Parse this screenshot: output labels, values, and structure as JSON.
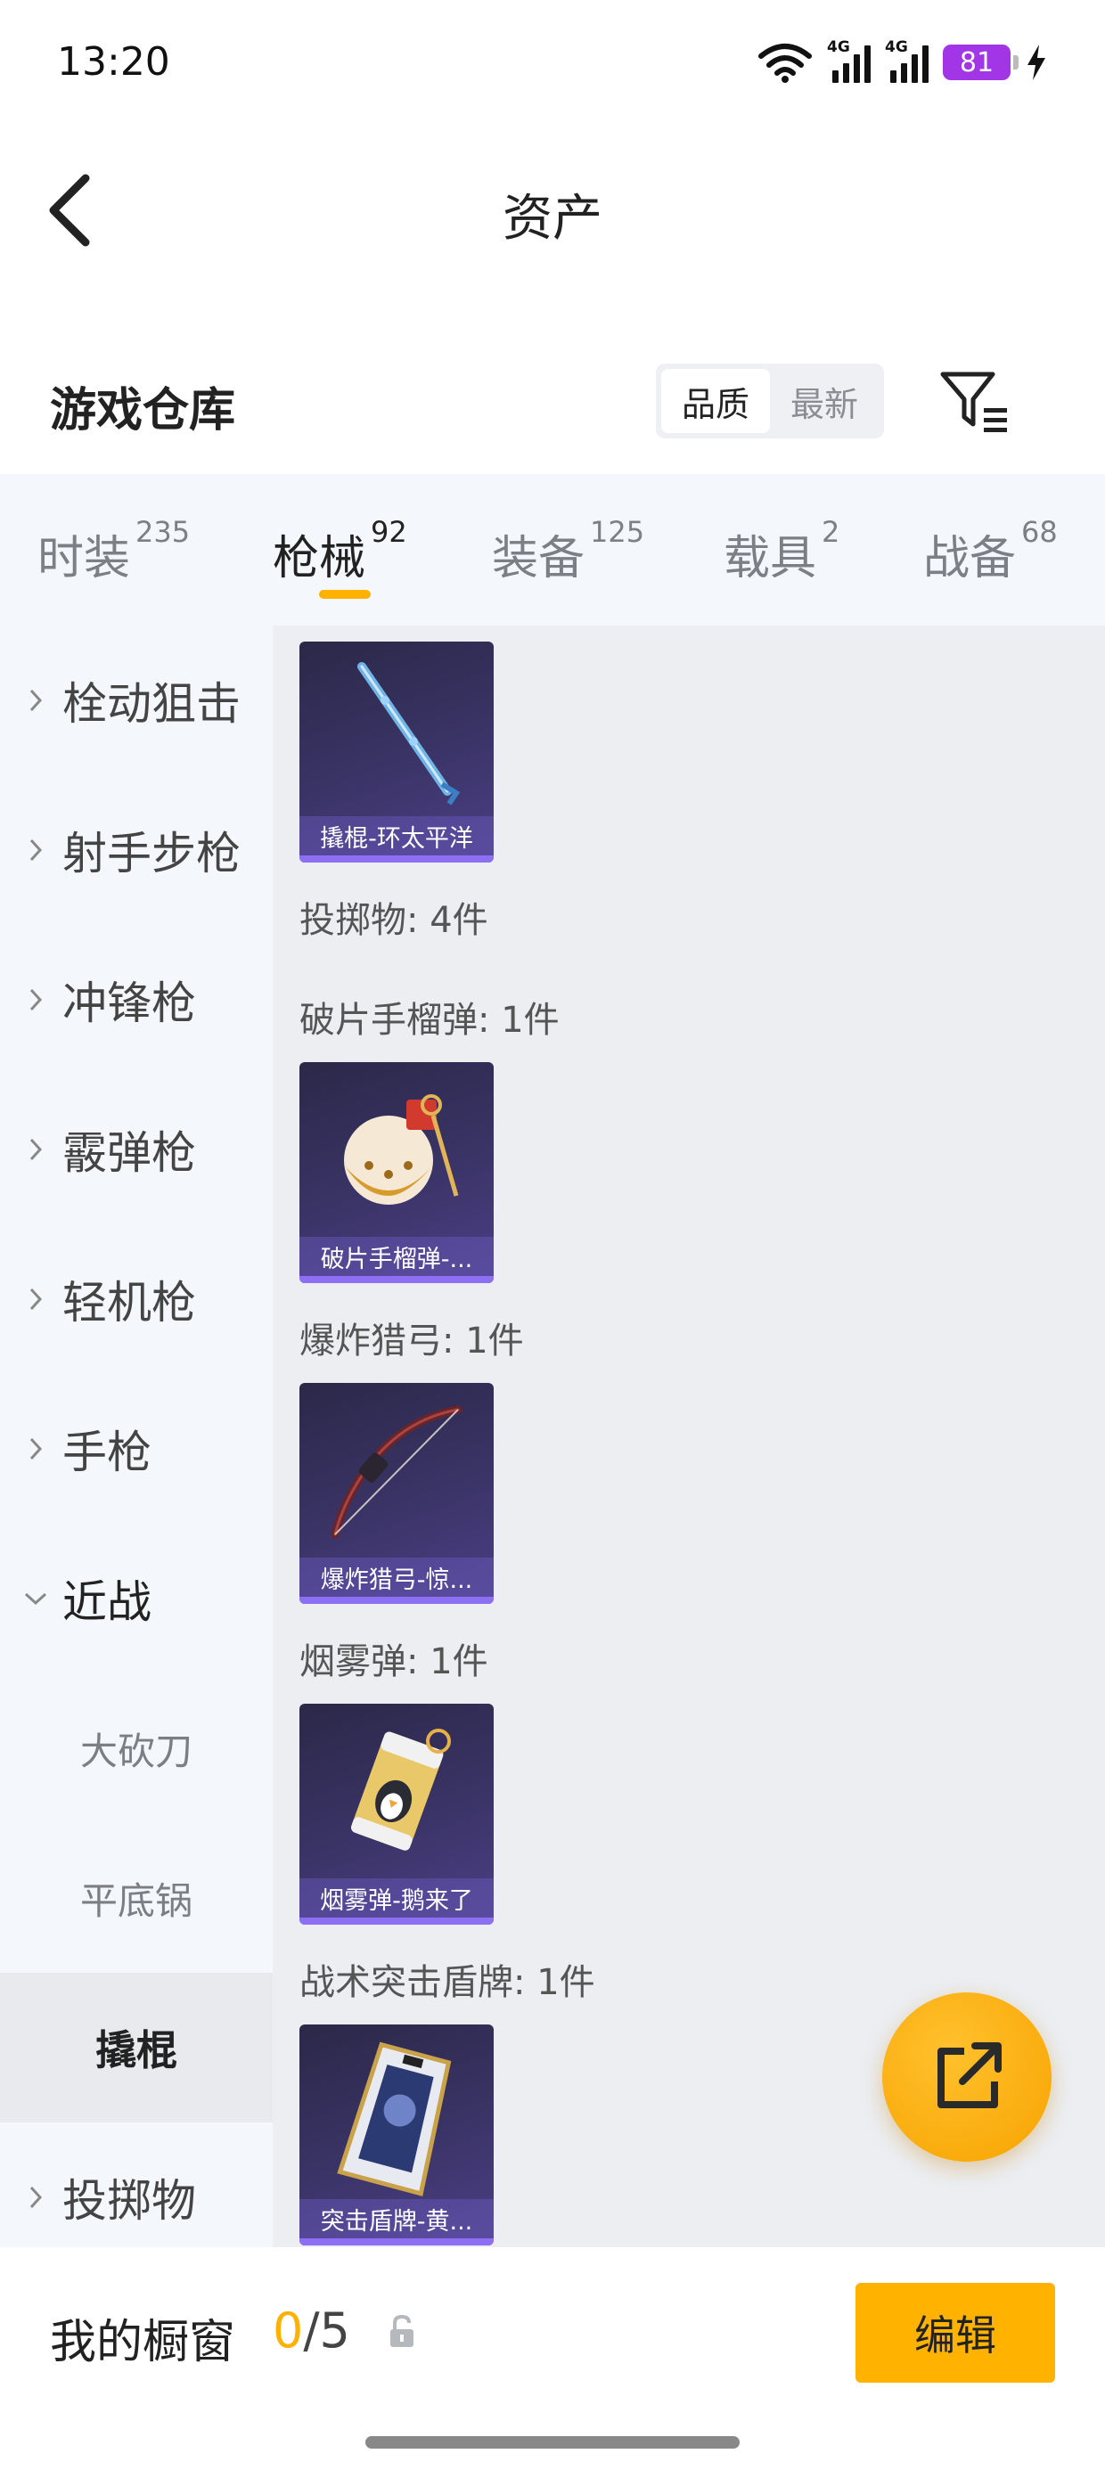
{
  "status_bar": {
    "time": "13:20",
    "network_1": "4G",
    "network_2": "4G",
    "battery": "81"
  },
  "header": {
    "title": "资产",
    "back_icon": "back-arrow-icon"
  },
  "warehouse": {
    "title": "游戏仓库",
    "sort_options": [
      "品质",
      "最新"
    ],
    "sort_selected": "品质",
    "filter_icon": "filter-icon"
  },
  "tabs": [
    {
      "label": "时装",
      "count": "235"
    },
    {
      "label": "枪械",
      "count": "92"
    },
    {
      "label": "装备",
      "count": "125"
    },
    {
      "label": "载具",
      "count": "2"
    },
    {
      "label": "战备",
      "count": "68"
    }
  ],
  "active_tab": "枪械",
  "sidebar": {
    "categories": [
      {
        "label": "栓动狙击"
      },
      {
        "label": "射手步枪"
      },
      {
        "label": "冲锋枪"
      },
      {
        "label": "霰弹枪"
      },
      {
        "label": "轻机枪"
      },
      {
        "label": "手枪"
      },
      {
        "label": "近战"
      }
    ],
    "subcategories": [
      {
        "label": "大砍刀"
      },
      {
        "label": "平底锅"
      },
      {
        "label": "撬棍"
      }
    ],
    "after": {
      "label": "投掷物"
    },
    "selected": "撬棍"
  },
  "content": {
    "items": [
      {
        "caption": "撬棍-环太平洋"
      },
      {
        "caption": "破片手榴弹-..."
      },
      {
        "caption": "爆炸猎弓-惊..."
      },
      {
        "caption": "烟雾弹-鹅来了"
      },
      {
        "caption": "突击盾牌-黄..."
      }
    ],
    "groups": [
      {
        "label": "投掷物: 4件"
      },
      {
        "label": "破片手榴弹: 1件"
      },
      {
        "label": "爆炸猎弓: 1件"
      },
      {
        "label": "烟雾弹: 1件"
      },
      {
        "label": "战术突击盾牌: 1件"
      }
    ]
  },
  "fab": {
    "icon": "share-external-icon"
  },
  "showcase": {
    "title": "我的橱窗",
    "current": "0",
    "total": "/5",
    "edit_label": "编辑"
  },
  "colors": {
    "accent": "#ffb100",
    "battery": "#a235e6",
    "card_bg": "#3b3467",
    "tab_bg": "#f4f7fb",
    "content_bg": "#eceef2"
  }
}
